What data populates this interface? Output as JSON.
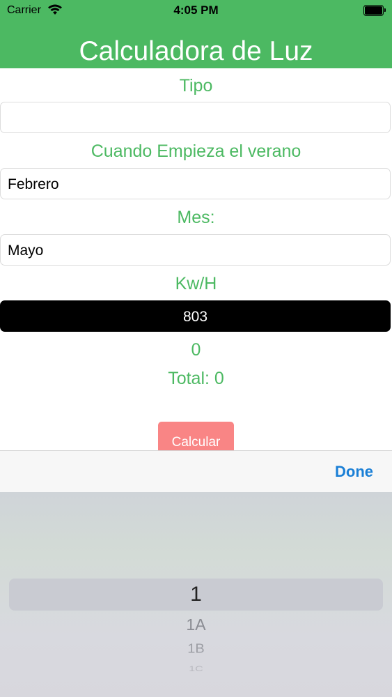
{
  "status_bar": {
    "carrier": "Carrier",
    "time": "4:05 PM"
  },
  "header": {
    "title": "Calculadora de Luz"
  },
  "form": {
    "tipo_label": "Tipo",
    "tipo_value": "",
    "verano_label": "Cuando Empieza el verano",
    "verano_value": "Febrero",
    "mes_label": "Mes:",
    "mes_value": "Mayo",
    "kwh_label": "Kw/H",
    "kwh_value": "803",
    "result_value": "0",
    "total_text": "Total: 0",
    "calcular_label": "Calcular"
  },
  "toolbar": {
    "done_label": "Done"
  },
  "picker": {
    "items": [
      "1",
      "1A",
      "1B",
      "1C"
    ]
  },
  "colors": {
    "accent": "#4cb962",
    "button": "#f98585",
    "done": "#1a7fd6"
  }
}
